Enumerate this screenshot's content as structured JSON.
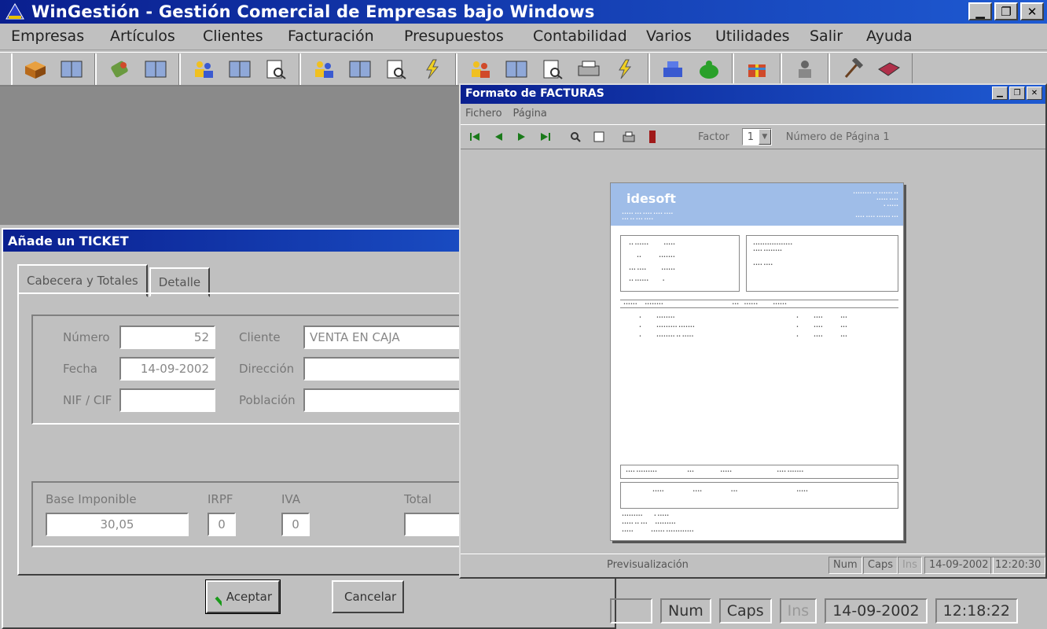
{
  "window": {
    "title": "WinGestión - Gestión Comercial de Empresas bajo Windows"
  },
  "menu": [
    "Empresas",
    "Artículos",
    "Clientes",
    "Facturación",
    "Presupuestos",
    "Contabilidad",
    "Varios",
    "Utilidades",
    "Salir",
    "Ayuda"
  ],
  "ticket": {
    "title": "Añade un TICKET",
    "tabs": [
      "Cabecera y Totales",
      "Detalle"
    ],
    "fields": {
      "numero_label": "Número",
      "numero_value": "52",
      "fecha_label": "Fecha",
      "fecha_value": "14-09-2002",
      "nif_label": "NIF / CIF",
      "cliente_label": "Cliente",
      "cliente_value": "VENTA EN CAJA",
      "direccion_label": "Dirección",
      "poblacion_label": "Población"
    },
    "totals": {
      "base_label": "Base Imponible",
      "base_value": "30,05",
      "irpf_label": "IRPF",
      "irpf_value": "0",
      "iva_label": "IVA",
      "iva_value": "0",
      "total_label": "Total"
    },
    "buttons": {
      "accept": "Aceptar",
      "cancel": "Cancelar"
    }
  },
  "preview": {
    "title": "Formato de FACTURAS",
    "menu": [
      "Fichero",
      "Página"
    ],
    "zoom_label": "Factor",
    "zoom_value": "1",
    "page_number": "Número de Página 1",
    "status": {
      "left": "Previsualización",
      "num": "Num",
      "caps": "Caps",
      "ins": "Ins",
      "date": "14-09-2002",
      "time": "12:20:30"
    },
    "logo": "idesoft"
  },
  "status": {
    "num": "Num",
    "caps": "Caps",
    "ins": "Ins",
    "date": "14-09-2002",
    "time": "12:18:22"
  },
  "colors": {
    "title_start": "#0a1f8f",
    "title_end": "#1e5ad2",
    "face": "#c0c0c0",
    "workspace": "#8a8a8a",
    "invoice_header": "#9fbde8"
  },
  "icons": {
    "accept": "green-check-icon",
    "cancel": "red-x-icon"
  }
}
